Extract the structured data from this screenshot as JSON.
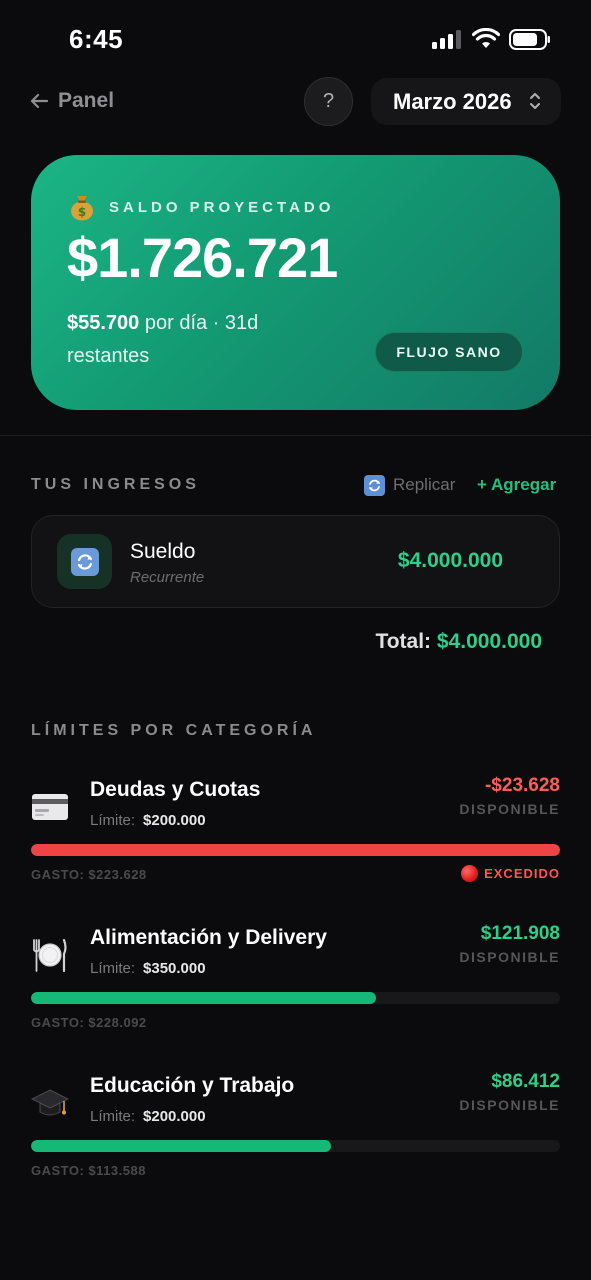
{
  "status_bar": {
    "time": "6:45"
  },
  "nav": {
    "back_label": "Panel",
    "help_label": "?",
    "month_label": "Marzo 2026"
  },
  "hero": {
    "label": "SALDO PROYECTADO",
    "amount": "$1.726.721",
    "daily_amount": "$55.700",
    "daily_suffix": " por día · 31d restantes",
    "badge": "FLUJO SANO"
  },
  "income": {
    "section_title": "TUS INGRESOS",
    "replicate_label": "Replicar",
    "add_label": "+ Agregar",
    "items": [
      {
        "name": "Sueldo",
        "type": "Recurrente",
        "amount": "$4.000.000"
      }
    ],
    "total_label": "Total: ",
    "total_value": "$4.000.000"
  },
  "limits": {
    "section_title": "LÍMITES POR CATEGORÍA",
    "limit_label": "Límite:",
    "available_label": "DISPONIBLE",
    "items": [
      {
        "icon": "credit-card-icon",
        "name": "Deudas y Cuotas",
        "limit": "$200.000",
        "available": "-$23.628",
        "available_color": "#ff5c5c",
        "progress": 1.0,
        "bar_color": "#ef4444",
        "spent": "GASTO: $223.628",
        "status": "EXCEDIDO"
      },
      {
        "icon": "plate-icon",
        "name": "Alimentación y Delivery",
        "limit": "$350.000",
        "available": "$121.908",
        "available_color": "#2bd08a",
        "progress": 0.652,
        "bar_color": "#15b877",
        "spent": "GASTO: $228.092",
        "status": ""
      },
      {
        "icon": "graduation-cap-icon",
        "name": "Educación y Trabajo",
        "limit": "$200.000",
        "available": "$86.412",
        "available_color": "#2bd08a",
        "progress": 0.568,
        "bar_color": "#15b877",
        "spent": "GASTO: $113.588",
        "status": ""
      }
    ]
  }
}
